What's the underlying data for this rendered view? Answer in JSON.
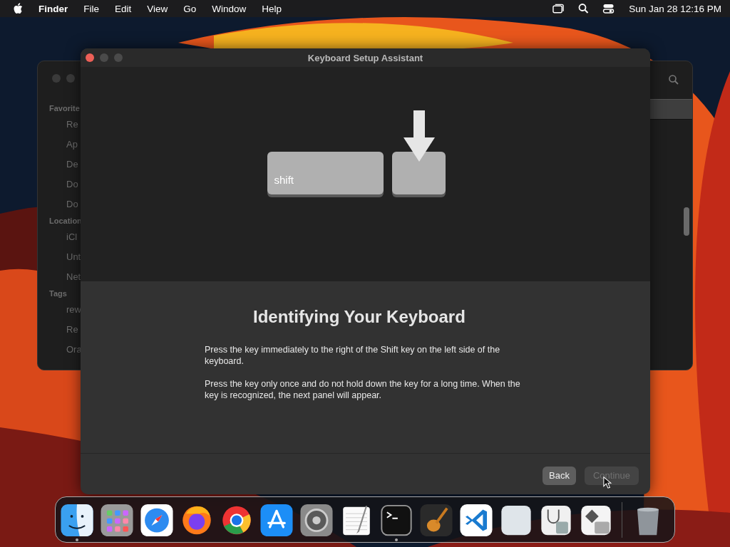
{
  "menu_bar": {
    "app_name": "Finder",
    "menus": [
      "File",
      "Edit",
      "View",
      "Go",
      "Window",
      "Help"
    ],
    "clock": "Sun Jan 28  12:16 PM"
  },
  "finder_window": {
    "sections": [
      {
        "heading": "Favorite",
        "items": [
          "Re",
          "Ap",
          "De",
          "Do",
          "Do"
        ]
      },
      {
        "heading": "Location",
        "items": [
          "iCl",
          "Unt",
          "Net"
        ]
      },
      {
        "heading": "Tags",
        "items": [
          "rew",
          "Re",
          "Ora"
        ]
      }
    ]
  },
  "dialog": {
    "title": "Keyboard Setup Assistant",
    "keys": [
      {
        "kind": "wide",
        "label": "shift"
      },
      {
        "kind": "target"
      }
    ],
    "heading": "Identifying Your Keyboard",
    "paragraphs": [
      "Press the key immediately to the right of the Shift key on the left side of the keyboard.",
      "Press the key only once and do not hold down the key for a long time. When the key is recognized, the next panel will appear."
    ],
    "buttons": [
      {
        "label": "Back",
        "disabled": false
      },
      {
        "label": "Continue",
        "disabled": true
      }
    ]
  },
  "dock": {
    "apps": [
      {
        "kind": "finder",
        "running": true
      },
      {
        "kind": "launchpad",
        "running": false
      },
      {
        "kind": "safari",
        "running": false
      },
      {
        "kind": "firefox",
        "running": false
      },
      {
        "kind": "chrome",
        "running": false
      },
      {
        "kind": "appstore",
        "running": false
      },
      {
        "kind": "settings",
        "running": false
      },
      {
        "kind": "textedit",
        "running": false
      },
      {
        "kind": "terminal",
        "running": true
      },
      {
        "kind": "garageband",
        "running": false
      },
      {
        "kind": "vscode",
        "running": false
      },
      {
        "kind": "blank",
        "running": false
      },
      {
        "kind": "diskutility",
        "running": false
      },
      {
        "kind": "bootcamp",
        "running": false
      },
      {
        "kind": "trash",
        "running": false
      }
    ]
  }
}
